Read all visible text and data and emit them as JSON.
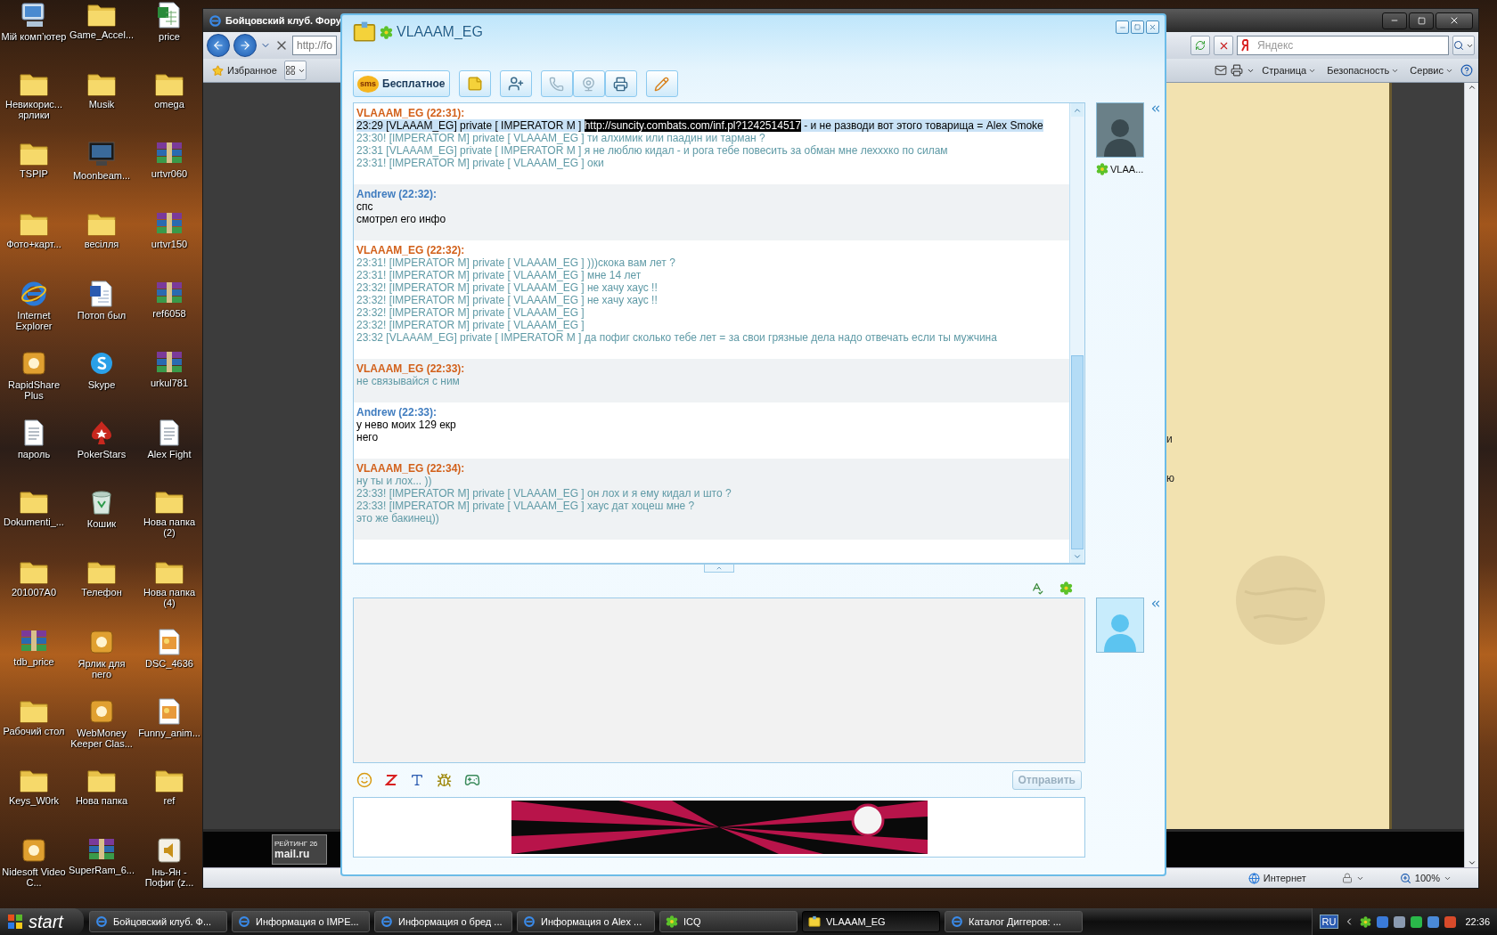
{
  "desktop": {
    "icons": [
      {
        "label": "Мій комп’ютер",
        "kind": "computer"
      },
      {
        "label": "Game_Accel...",
        "kind": "folder"
      },
      {
        "label": "price",
        "kind": "sheet"
      },
      {
        "label": "Невикорис... ярлики",
        "kind": "folder"
      },
      {
        "label": "Musik",
        "kind": "folder"
      },
      {
        "label": "omega",
        "kind": "folder"
      },
      {
        "label": "TSPIP",
        "kind": "folder"
      },
      {
        "label": "Moonbeam...",
        "kind": "monitor"
      },
      {
        "label": "urtvr060",
        "kind": "archive"
      },
      {
        "label": "Фото+карт...",
        "kind": "folder"
      },
      {
        "label": "весілля",
        "kind": "folder"
      },
      {
        "label": "urtvr150",
        "kind": "archive"
      },
      {
        "label": "Internet Explorer",
        "kind": "browser"
      },
      {
        "label": "Потоп был",
        "kind": "document"
      },
      {
        "label": "ref6058",
        "kind": "archive"
      },
      {
        "label": "RapidShare Plus",
        "kind": "app"
      },
      {
        "label": "Skype",
        "kind": "skype"
      },
      {
        "label": "urkul781",
        "kind": "archive"
      },
      {
        "label": "пароль",
        "kind": "text"
      },
      {
        "label": "PokerStars",
        "kind": "poker"
      },
      {
        "label": "Alex Fight",
        "kind": "text"
      },
      {
        "label": "Dokumenti_...",
        "kind": "folder"
      },
      {
        "label": "Кошик",
        "kind": "bin"
      },
      {
        "label": "Нова папка (2)",
        "kind": "folder"
      },
      {
        "label": "201007A0",
        "kind": "folder"
      },
      {
        "label": "Телефон",
        "kind": "folder"
      },
      {
        "label": "Нова папка (4)",
        "kind": "folder"
      },
      {
        "label": "tdb_price",
        "kind": "archive"
      },
      {
        "label": "Ярлик для nero",
        "kind": "app"
      },
      {
        "label": "DSC_4636",
        "kind": "image"
      },
      {
        "label": "Рабочий стол",
        "kind": "folder"
      },
      {
        "label": "WebMoney Keeper Clas...",
        "kind": "app"
      },
      {
        "label": "Funny_anim...",
        "kind": "image"
      },
      {
        "label": "Keys_W0rk",
        "kind": "folder"
      },
      {
        "label": "Нова папка",
        "kind": "folder"
      },
      {
        "label": "ref",
        "kind": "folder"
      },
      {
        "label": "Nidesoft Video C...",
        "kind": "app"
      },
      {
        "label": "SuperRam_6...",
        "kind": "archive"
      },
      {
        "label": "Інь-Ян - Пофиг (z...",
        "kind": "audio"
      }
    ]
  },
  "browser": {
    "title": "Бойцовский клуб. Фору",
    "address": "http://fo",
    "search_placeholder": "Яндекс",
    "favorites": "Избранное",
    "commands": [
      "Страница",
      "Безопасность",
      "Сервис"
    ],
    "page_fragments": [
      "и",
      "ю"
    ],
    "counter": {
      "label": "РЕЙТИНГ 26",
      "brand": "mail.ru"
    },
    "status": {
      "zone": "Интернет",
      "zoom": "100%"
    }
  },
  "icq": {
    "title": "VLAAAM_EG",
    "sms_badge": "sms",
    "sms_button": "Бесплатное",
    "contact_name": "VLAA...",
    "send_button": {
      "label": "Отправить",
      "disabled": true
    },
    "messages": [
      {
        "header": "VLAAAM_EG (22:31):",
        "color": "#d2601a",
        "kind": "incoming",
        "lines": [
          {
            "kind": "selection",
            "parts": [
              {
                "text": "23:29 [VLAAAM_EG] private [ IMPERATOR M ] ",
                "kind": "text"
              },
              {
                "text": "http://suncity.combats.com/inf.pl?1242514517",
                "kind": "link"
              },
              {
                "text": " - и не разводи вот этого товарища = Alex Smoke",
                "kind": "text"
              }
            ]
          },
          {
            "kind": "line",
            "text": "23:30! [IMPERATOR M] private [ VLAAAM_EG ] ти алхимик или паадин ии тарман ?"
          },
          {
            "kind": "line",
            "text": "23:31 [VLAAAM_EG] private [ IMPERATOR M ] я не люблю кидал - и рога тебе повесить за обман мне лехххко по силам"
          },
          {
            "kind": "line",
            "text": "23:31! [IMPERATOR M] private [ VLAAAM_EG ] оки"
          }
        ]
      },
      {
        "header": "Andrew (22:32):",
        "color": "#3f7cbf",
        "kind": "outgoing",
        "lines": [
          {
            "kind": "line",
            "text": "спс"
          },
          {
            "kind": "line",
            "text": "смотрел его инфо"
          }
        ]
      },
      {
        "header": "VLAAAM_EG (22:32):",
        "color": "#d2601a",
        "kind": "incoming",
        "lines": [
          {
            "kind": "line",
            "text": "23:31! [IMPERATOR M] private [ VLAAAM_EG ] )))скока вам лет ?"
          },
          {
            "kind": "line",
            "text": "23:31! [IMPERATOR M] private [ VLAAAM_EG ] мне 14 лет"
          },
          {
            "kind": "line",
            "text": "23:32! [IMPERATOR M] private [ VLAAAM_EG ] не хачу хаус !!"
          },
          {
            "kind": "line",
            "text": "23:32! [IMPERATOR M] private [ VLAAAM_EG ] не хачу хаус !!"
          },
          {
            "kind": "line",
            "text": "23:32! [IMPERATOR M] private [ VLAAAM_EG ]"
          },
          {
            "kind": "line",
            "text": "23:32! [IMPERATOR M] private [ VLAAAM_EG ]"
          },
          {
            "kind": "line",
            "text": "23:32 [VLAAAM_EG] private [ IMPERATOR M ] да пофиг сколько тебе лет = за свои грязные дела надо отвечать если ты мужчина"
          }
        ]
      },
      {
        "header": "VLAAAM_EG (22:33):",
        "color": "#d2601a",
        "kind": "incoming",
        "lines": [
          {
            "kind": "line",
            "text": "не связывайся с ним"
          }
        ]
      },
      {
        "header": "Andrew (22:33):",
        "color": "#3f7cbf",
        "kind": "outgoing",
        "lines": [
          {
            "kind": "line",
            "text": "у нево моих 129 екр"
          },
          {
            "kind": "line",
            "text": "него"
          }
        ]
      },
      {
        "header": "VLAAAM_EG (22:34):",
        "color": "#d2601a",
        "kind": "incoming",
        "lines": [
          {
            "kind": "line",
            "text": "ну ты и лох... ))"
          },
          {
            "kind": "line",
            "text": "23:33! [IMPERATOR M] private [ VLAAAM_EG ] он лох и я ему кидал и што ?"
          },
          {
            "kind": "line",
            "text": "23:33! [IMPERATOR M] private [ VLAAAM_EG ] хаус дат хоцеш мне ?"
          },
          {
            "kind": "line",
            "text": "это же бакинец))"
          }
        ]
      }
    ]
  },
  "taskbar": {
    "start": "start",
    "tasks": [
      {
        "label": "Бойцовский клуб. Ф...",
        "kind": "browser",
        "selected": false
      },
      {
        "label": "Информация о IMPE...",
        "kind": "browser",
        "selected": false
      },
      {
        "label": "Информация о бред ...",
        "kind": "browser",
        "selected": false
      },
      {
        "label": "Информация о Alex ...",
        "kind": "browser",
        "selected": false
      },
      {
        "label": "ICQ",
        "kind": "messenger",
        "selected": false
      },
      {
        "label": "VLAAAM_EG",
        "kind": "chat",
        "selected": true
      },
      {
        "label": "Каталог Диггеров: ...",
        "kind": "browser",
        "selected": false
      }
    ],
    "language": "RU",
    "clock": "22:36"
  }
}
